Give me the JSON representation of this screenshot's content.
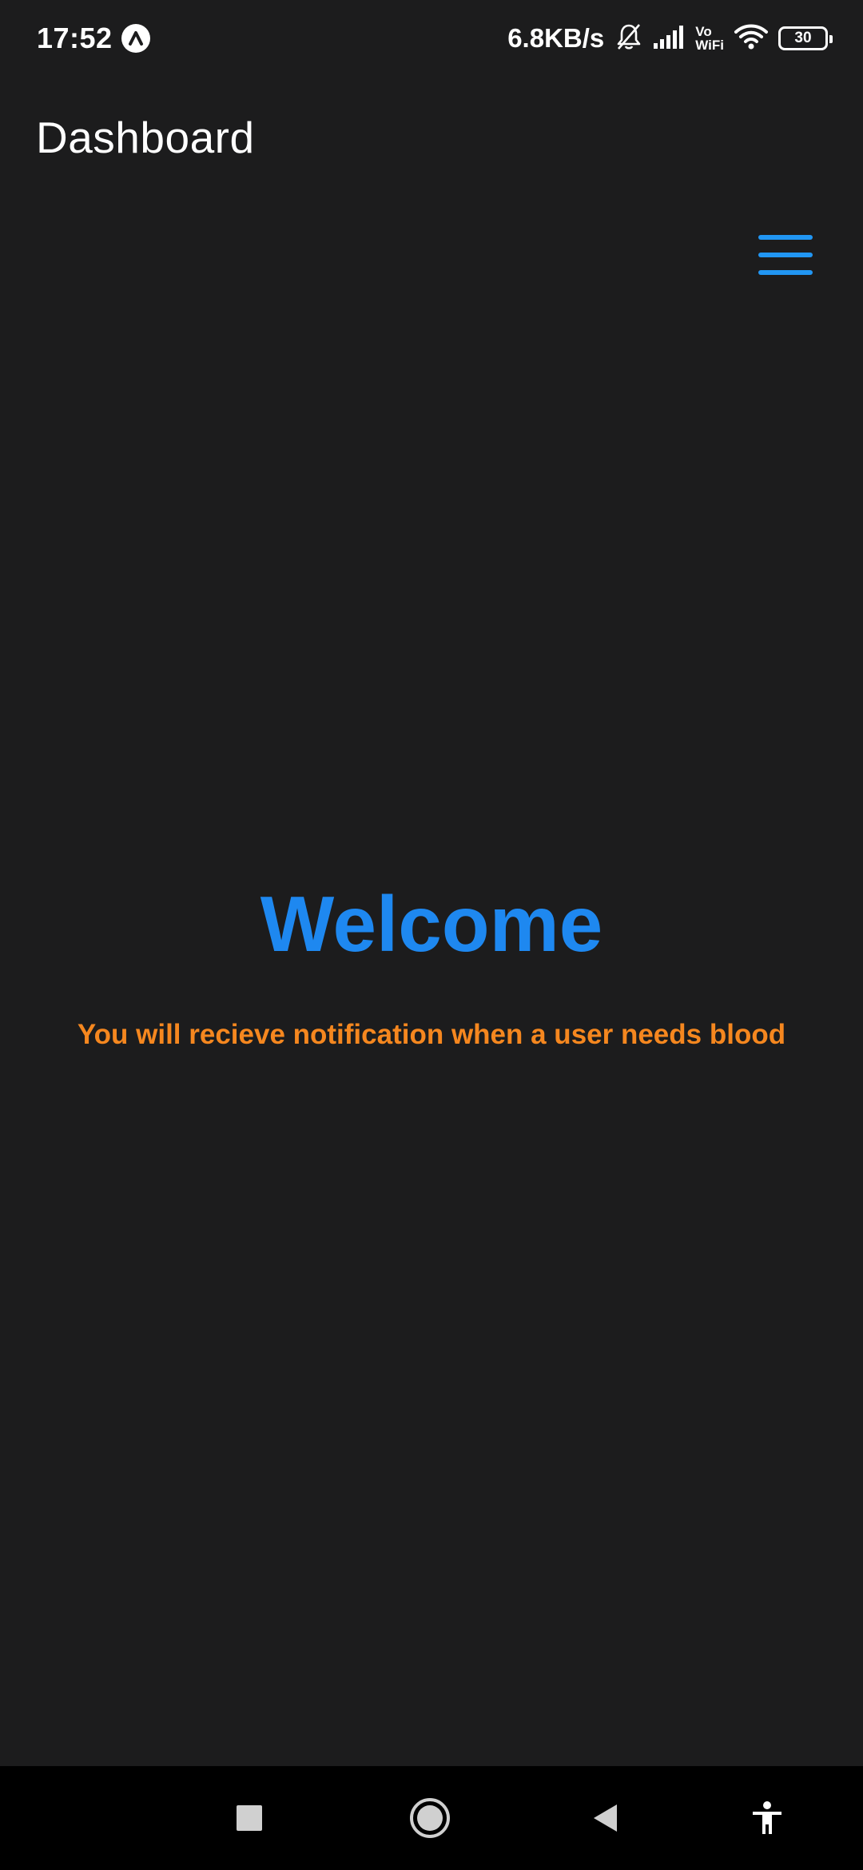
{
  "status_bar": {
    "time": "17:52",
    "net_speed": "6.8KB/s",
    "vowifi_top": "Vo",
    "vowifi_bottom": "WiFi",
    "battery": "30",
    "icons": [
      "app-notification-icon",
      "bell-muted-icon",
      "signal-icon",
      "vowifi-icon",
      "wifi-icon",
      "battery-icon"
    ]
  },
  "app_bar": {
    "title": "Dashboard",
    "menu_icon": "hamburger-menu-icon"
  },
  "content": {
    "welcome": "Welcome",
    "notice": "You will recieve notification when a user needs blood"
  },
  "nav_bar": {
    "icons": [
      "recent-apps-icon",
      "home-icon",
      "back-icon",
      "accessibility-icon"
    ]
  },
  "colors": {
    "background": "#1c1c1d",
    "accent_blue": "#1e88f0",
    "accent_orange": "#f5871f",
    "nav_bar": "#000000"
  }
}
